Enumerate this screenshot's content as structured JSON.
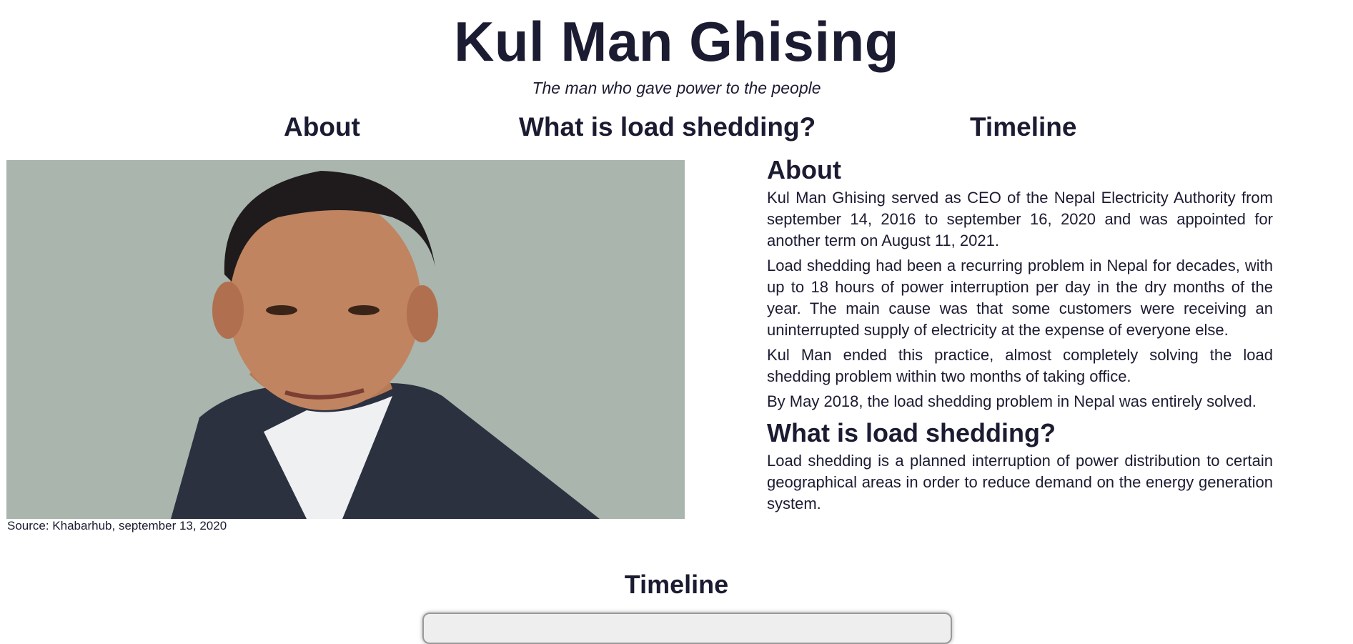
{
  "header": {
    "title": "Kul Man Ghising",
    "subtitle": "The man who gave power to the people"
  },
  "nav": {
    "items": [
      {
        "label": "About"
      },
      {
        "label": "What is load shedding?"
      },
      {
        "label": "Timeline"
      }
    ]
  },
  "image": {
    "caption": "Source: Khabarhub, september 13, 2020",
    "background_color": "#a9b5ad"
  },
  "about": {
    "heading": "About",
    "paragraphs": [
      "Kul Man Ghising served as CEO of the Nepal Electricity Authority from september 14, 2016 to september 16, 2020 and was appointed for another term on August 11, 2021.",
      "Load shedding had been a recurring problem in Nepal for decades, with up to 18 hours of power interruption per day in the dry months of the year. The main cause was that some customers were receiving an uninterrupted supply of electricity at the expense of everyone else.",
      "Kul Man ended this practice, almost completely solving the load shedding problem within two months of taking office.",
      "By May 2018, the load shedding problem in Nepal was entirely solved."
    ]
  },
  "load_shedding": {
    "heading": "What is load shedding?",
    "paragraph": "Load shedding is a planned interruption of power distribution to certain geographical areas in order to reduce demand on the energy generation system."
  },
  "timeline": {
    "heading": "Timeline"
  },
  "colors": {
    "text": "#1b1b32",
    "background": "#ffffff"
  }
}
